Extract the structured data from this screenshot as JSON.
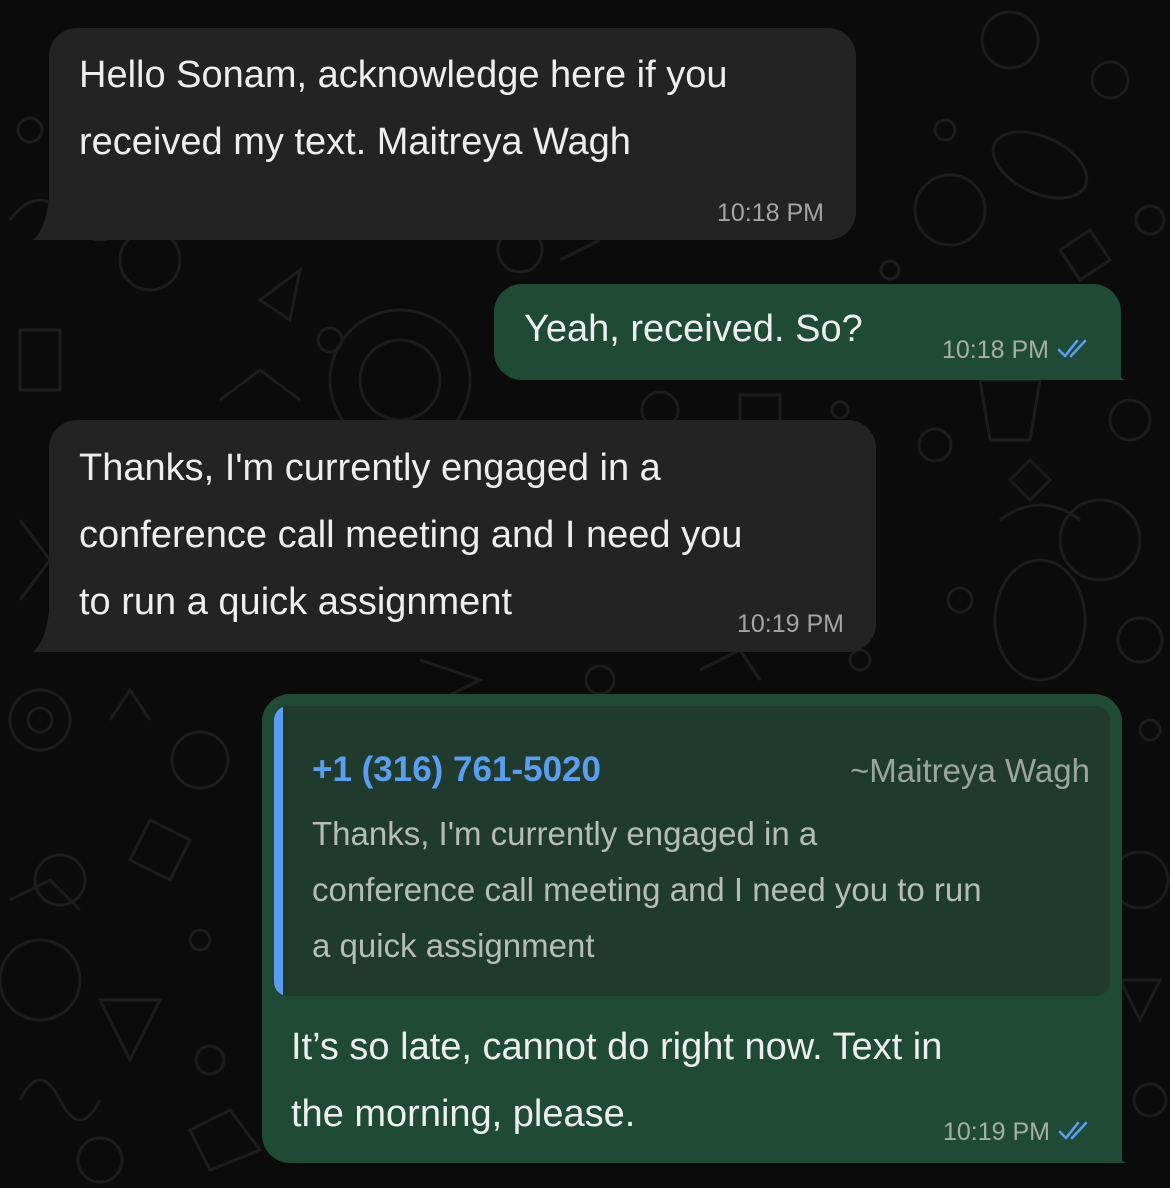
{
  "chat": {
    "messages": [
      {
        "direction": "incoming",
        "lines": [
          "Hello Sonam, acknowledge here if you",
          "received my text. Maitreya Wagh"
        ],
        "time": "10:18 PM"
      },
      {
        "direction": "outgoing",
        "lines": [
          "Yeah, received. So?"
        ],
        "time": "10:18 PM",
        "status": "read-double-check-icon"
      },
      {
        "direction": "incoming",
        "lines": [
          "Thanks, I'm currently engaged in a",
          "conference call meeting and I need you",
          "to run a quick assignment"
        ],
        "time": "10:19 PM"
      },
      {
        "direction": "outgoing",
        "quoted": {
          "sender": "+1 (316) 761-5020",
          "name": "~Maitreya Wagh",
          "lines": [
            "Thanks, I'm currently engaged in a",
            "conference call meeting and I need you to run",
            "a quick assignment"
          ]
        },
        "lines": [
          "It’s so late, cannot do right now. Text in",
          "the morning, please."
        ],
        "time": "10:19 PM",
        "status": "read-double-check-icon"
      }
    ]
  },
  "colors": {
    "background": "#0b0b0b",
    "incoming_bubble": "#232323",
    "outgoing_bubble": "#1f4a36",
    "quote_background": "#203b2e",
    "quote_accent": "#5b9ef0",
    "read_ticks": "#5b9ef0"
  }
}
